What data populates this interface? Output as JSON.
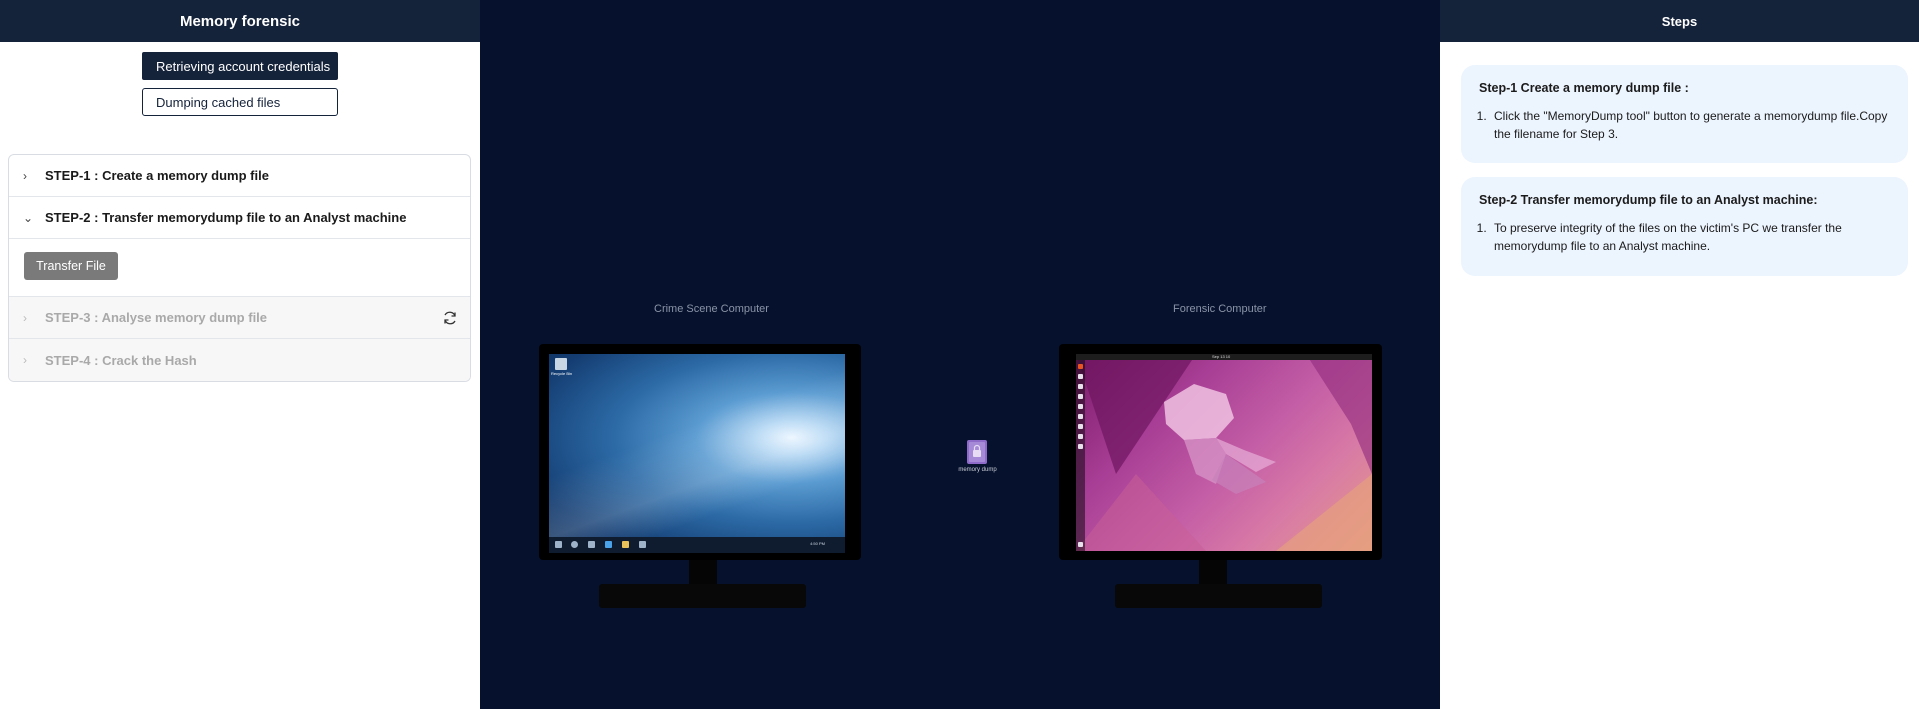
{
  "left_panel": {
    "title": "Memory forensic",
    "modes": {
      "active": "Retrieving account credentials",
      "inactive": "Dumping cached files"
    },
    "steps": [
      {
        "label": "STEP-1 : Create a memory dump file",
        "state": "collapsed"
      },
      {
        "label": "STEP-2 : Transfer memorydump file to an Analyst machine",
        "state": "expanded"
      },
      {
        "label": "STEP-3 : Analyse memory dump file",
        "state": "disabled"
      },
      {
        "label": "STEP-4 : Crack the Hash",
        "state": "disabled"
      }
    ],
    "transfer_button": "Transfer File"
  },
  "scene": {
    "crime_label": "Crime Scene Computer",
    "forensic_label": "Forensic Computer",
    "file_label": "memory dump",
    "win_desktop_icon": "Recycle Bin",
    "win_clock": "4:50 PM",
    "ubu_clock": "Sep 13 10"
  },
  "right_panel": {
    "title": "Steps",
    "cards": [
      {
        "heading": "Step-1 Create a memory dump file :",
        "items": [
          "Click the \"MemoryDump tool\" button to generate a memorydump file.Copy the filename for Step 3."
        ]
      },
      {
        "heading": "Step-2 Transfer memorydump file to an Analyst machine:",
        "items": [
          "To preserve integrity of the files on the victim's PC we transfer the memorydump file to an Analyst machine."
        ]
      }
    ]
  },
  "colors": {
    "header_bg": "#14223a",
    "scene_bg": "#06122d",
    "card_bg": "#ecf4fe",
    "button_disabled": "#7a7a7a"
  }
}
